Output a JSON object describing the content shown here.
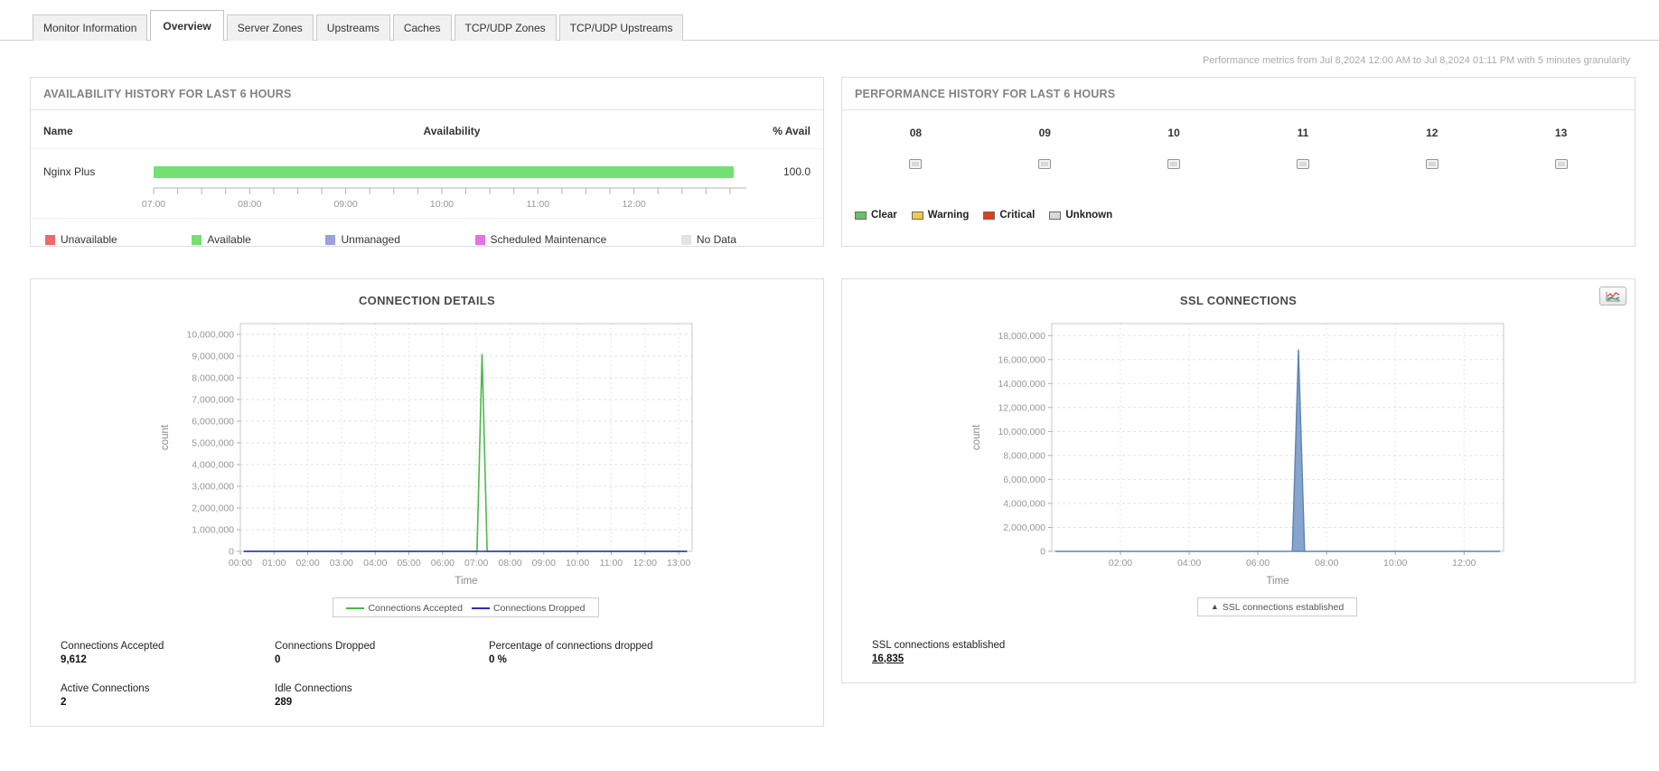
{
  "tabs": {
    "items": [
      {
        "label": "Monitor Information",
        "active": false
      },
      {
        "label": "Overview",
        "active": true
      },
      {
        "label": "Server Zones",
        "active": false
      },
      {
        "label": "Upstreams",
        "active": false
      },
      {
        "label": "Caches",
        "active": false
      },
      {
        "label": "TCP/UDP Zones",
        "active": false
      },
      {
        "label": "TCP/UDP Upstreams",
        "active": false
      }
    ]
  },
  "meta_note": "Performance metrics from Jul 8,2024 12:00 AM to Jul 8,2024 01:11 PM with 5 minutes granularity",
  "availability": {
    "title": "AVAILABILITY HISTORY FOR LAST 6 HOURS",
    "col_name": "Name",
    "col_availability": "Availability",
    "col_percent": "% Avail",
    "monitor_name": "Nginx Plus",
    "percent_value": "100.0",
    "bar_color": "#72e072",
    "timeline": {
      "start_hour": 7,
      "end_hour": 13.17,
      "bar_end_hour": 13.0,
      "tick_interval_min": 15,
      "hour_labels": [
        "07:00",
        "08:00",
        "09:00",
        "10:00",
        "11:00",
        "12:00"
      ]
    },
    "legend": [
      {
        "label": "Unavailable",
        "color": "#ed6a6a"
      },
      {
        "label": "Available",
        "color": "#72e072"
      },
      {
        "label": "Unmanaged",
        "color": "#9e9ee2"
      },
      {
        "label": "Scheduled Maintenance",
        "color": "#e673e6"
      },
      {
        "label": "No Data",
        "color": "#e3e3e3"
      }
    ]
  },
  "performance": {
    "title": "PERFORMANCE HISTORY FOR LAST 6 HOURS",
    "hours": [
      "08",
      "09",
      "10",
      "11",
      "12",
      "13"
    ],
    "hour_status": [
      "unknown",
      "unknown",
      "unknown",
      "unknown",
      "unknown",
      "unknown"
    ],
    "legend": [
      {
        "label": "Clear",
        "color": "#68c068"
      },
      {
        "label": "Warning",
        "color": "#efc94c"
      },
      {
        "label": "Critical",
        "color": "#e23b1d"
      },
      {
        "label": "Unknown",
        "color": "#d9d9d9"
      }
    ]
  },
  "chart_data": [
    {
      "type": "line",
      "title": "CONNECTION DETAILS",
      "xlabel": "Time",
      "ylabel": "count",
      "x_range_hours": [
        0,
        13.4
      ],
      "x_grid_step_hours": 1,
      "x_grid_start_hours": 1,
      "ylim": [
        0,
        10500000
      ],
      "y_tick_step": 1000000,
      "y_tick_max": 10000000,
      "grid": true,
      "legend_position": "bottom",
      "x_ticks": [
        {
          "hour": 0,
          "label": "00:00"
        },
        {
          "hour": 1,
          "label": "01:00"
        },
        {
          "hour": 2,
          "label": "02:00"
        },
        {
          "hour": 3,
          "label": "03:00"
        },
        {
          "hour": 4,
          "label": "04:00"
        },
        {
          "hour": 5,
          "label": "05:00"
        },
        {
          "hour": 6,
          "label": "06:00"
        },
        {
          "hour": 7,
          "label": "07:00"
        },
        {
          "hour": 8,
          "label": "08:00"
        },
        {
          "hour": 9,
          "label": "09:00"
        },
        {
          "hour": 10,
          "label": "10:00"
        },
        {
          "hour": 11,
          "label": "11:00"
        },
        {
          "hour": 12,
          "label": "12:00"
        },
        {
          "hour": 13,
          "label": "13:00"
        }
      ],
      "series": [
        {
          "name": "Connections Accepted",
          "color": "#4db84d",
          "type": "line",
          "points": [
            [
              0.1,
              0
            ],
            [
              7.02,
              0
            ],
            [
              7.17,
              9100000
            ],
            [
              7.32,
              0
            ],
            [
              13.25,
              0
            ]
          ]
        },
        {
          "name": "Connections Dropped",
          "color": "#2d2dbb",
          "type": "line",
          "points": [
            [
              0.1,
              0
            ],
            [
              13.25,
              0
            ]
          ]
        }
      ]
    },
    {
      "type": "area",
      "title": "SSL CONNECTIONS",
      "xlabel": "Time",
      "ylabel": "count",
      "x_range_hours": [
        0,
        13.15
      ],
      "x_grid_step_hours": 2,
      "x_grid_start_hours": 2,
      "ylim": [
        0,
        19000000
      ],
      "y_tick_step": 2000000,
      "y_tick_max": 18000000,
      "grid": true,
      "legend_position": "bottom",
      "x_ticks": [
        {
          "hour": 2,
          "label": "02:00"
        },
        {
          "hour": 4,
          "label": "04:00"
        },
        {
          "hour": 6,
          "label": "06:00"
        },
        {
          "hour": 8,
          "label": "08:00"
        },
        {
          "hour": 10,
          "label": "10:00"
        },
        {
          "hour": 12,
          "label": "12:00"
        }
      ],
      "series": [
        {
          "name": "SSL connections established",
          "color": "#5b83b5",
          "fill": "#87a5cc",
          "marker_color": "#2b4f8e",
          "type": "area",
          "points": [
            [
              0.1,
              0
            ],
            [
              7.0,
              0
            ],
            [
              7.18,
              16835000
            ],
            [
              7.36,
              0
            ],
            [
              13.05,
              0
            ]
          ]
        }
      ]
    }
  ],
  "connection_stats": {
    "accepted_label": "Connections Accepted",
    "accepted_value": "9,612",
    "dropped_label": "Connections Dropped",
    "dropped_value": "0",
    "pct_label": "Percentage of connections dropped",
    "pct_value": "0 %",
    "active_label": "Active Connections",
    "active_value": "2",
    "idle_label": "Idle Connections",
    "idle_value": "289"
  },
  "ssl_stats": {
    "established_label": "SSL connections established",
    "established_value": "16,835"
  }
}
